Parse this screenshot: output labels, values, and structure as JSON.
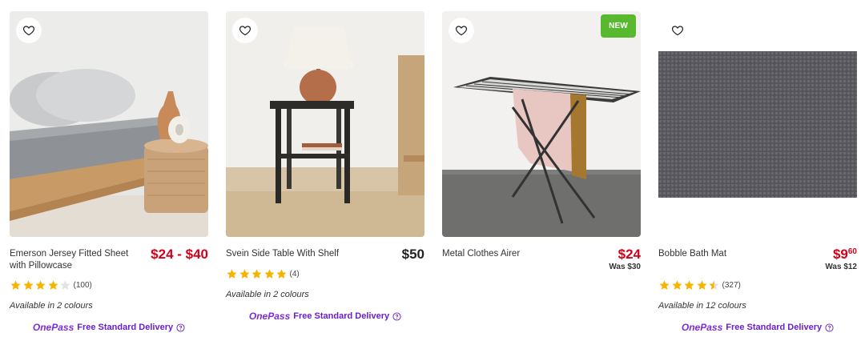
{
  "products": [
    {
      "title": "Emerson Jersey Fitted Sheet with Pillowcase",
      "price": "$24 - $40",
      "rating": 4.0,
      "review_count": "(100)",
      "colours": "Available in 2 colours",
      "delivery_brand": "OnePass",
      "delivery_text": "Free Standard Delivery",
      "wishlist_icon": "heart-outline-icon"
    },
    {
      "title": "Svein Side Table With Shelf",
      "price": "$50",
      "rating": 5.0,
      "review_count": "(4)",
      "colours": "Available in 2 colours",
      "delivery_brand": "OnePass",
      "delivery_text": "Free Standard Delivery",
      "wishlist_icon": "heart-outline-icon"
    },
    {
      "title": "Metal Clothes Airer",
      "price": "$24",
      "was_price": "Was $30",
      "badge": "NEW",
      "wishlist_icon": "heart-outline-icon"
    },
    {
      "title": "Bobble Bath Mat",
      "price_dollars": "$9",
      "price_cents": "60",
      "was_price": "Was $12",
      "rating": 4.5,
      "review_count": "(327)",
      "colours": "Available in 12 colours",
      "delivery_brand": "OnePass",
      "delivery_text": "Free Standard Delivery",
      "wishlist_icon": "heart-outline-icon"
    }
  ],
  "colors": {
    "sale_red": "#d0021b",
    "star_gold": "#f5b400",
    "onepass_purple": "#7c2bd8",
    "new_badge_green": "#58b82e"
  }
}
